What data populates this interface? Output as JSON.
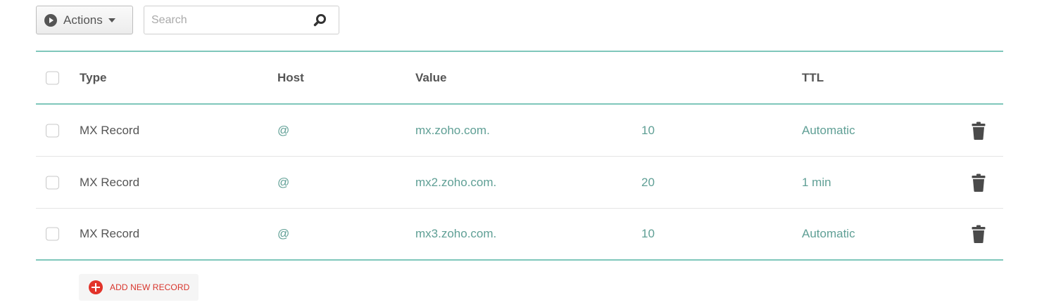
{
  "toolbar": {
    "actions_label": "Actions",
    "search_placeholder": "Search",
    "search_value": ""
  },
  "table": {
    "headers": {
      "type": "Type",
      "host": "Host",
      "value": "Value",
      "priority": "",
      "ttl": "TTL"
    },
    "rows": [
      {
        "type": "MX Record",
        "host": "@",
        "value": "mx.zoho.com.",
        "priority": "10",
        "ttl": "Automatic"
      },
      {
        "type": "MX Record",
        "host": "@",
        "value": "mx2.zoho.com.",
        "priority": "20",
        "ttl": "1 min"
      },
      {
        "type": "MX Record",
        "host": "@",
        "value": "mx3.zoho.com.",
        "priority": "10",
        "ttl": "Automatic"
      }
    ]
  },
  "footer": {
    "add_label": "ADD NEW RECORD"
  },
  "icons": {
    "actions": "play-circle-icon",
    "dropdown": "caret-down-icon",
    "search": "search-icon",
    "delete": "trash-icon",
    "add": "plus-circle-icon"
  },
  "colors": {
    "accent_teal": "#7fc7bb",
    "link_teal": "#5f9f95",
    "add_red": "#e2332a"
  }
}
